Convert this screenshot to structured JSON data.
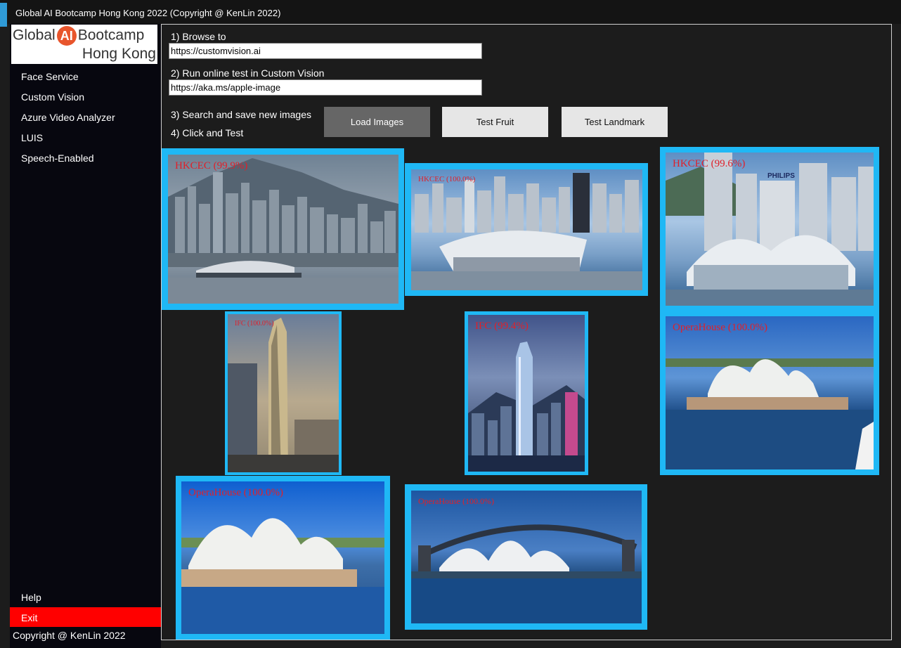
{
  "window": {
    "title": "Global AI Bootcamp Hong Kong 2022 (Copyright @ KenLin 2022)"
  },
  "logo": {
    "line1_left": "Global",
    "line1_badge": "AI",
    "line1_right": "Bootcamp",
    "line2": "Hong Kong"
  },
  "sidebar": {
    "items": [
      {
        "label": "Face Service"
      },
      {
        "label": "Custom Vision"
      },
      {
        "label": "Azure Video Analyzer"
      },
      {
        "label": "LUIS"
      },
      {
        "label": "Speech-Enabled"
      }
    ],
    "help_label": "Help",
    "exit_label": "Exit",
    "copyright": "Copyright @ KenLin 2022"
  },
  "steps": {
    "step1_label": "1) Browse to",
    "step1_value": "https://customvision.ai",
    "step2_label": "2) Run online test in Custom Vision",
    "step2_value": "https://aka.ms/apple-image",
    "step3_label": "3) Search and save new images",
    "step4_label": "4) Click and Test"
  },
  "buttons": {
    "load_images": "Load Images",
    "test_fruit": "Test Fruit",
    "test_landmark": "Test Landmark"
  },
  "gallery": {
    "images": [
      {
        "label": "HKCEC (99.9%)"
      },
      {
        "label": "HKCEC (100.0%)"
      },
      {
        "label": "HKCEC (99.6%)",
        "sign": "PHILIPS"
      },
      {
        "label": "IFC (100.0%)"
      },
      {
        "label": "IFC (99.4%)"
      },
      {
        "label": "OperaHouse (100.0%)"
      },
      {
        "label": "OperaHouse (100.0%)"
      },
      {
        "label": "OperaHouse (100.0%)"
      }
    ]
  },
  "colors": {
    "highlight_border": "#1fb8f5",
    "label_text": "#e0202a",
    "exit_background": "#ff0000",
    "window_background": "#1c1c1c"
  }
}
